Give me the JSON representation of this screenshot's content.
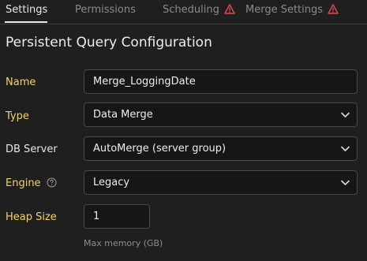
{
  "tabs": [
    {
      "label": "Settings",
      "active": true,
      "warning": false
    },
    {
      "label": "Permissions",
      "active": false,
      "warning": false
    },
    {
      "label": "Scheduling",
      "active": false,
      "warning": true
    },
    {
      "label": "Merge Settings",
      "active": false,
      "warning": true
    }
  ],
  "section_title": "Persistent Query Configuration",
  "form": {
    "name": {
      "label": "Name",
      "value": "Merge_LoggingDate"
    },
    "type": {
      "label": "Type",
      "value": "Data Merge"
    },
    "db_server": {
      "label": "DB Server",
      "value": "AutoMerge (server group)"
    },
    "engine": {
      "label": "Engine",
      "value": "Legacy"
    },
    "heap_size": {
      "label": "Heap Size",
      "value": "1",
      "hint": "Max memory (GB)"
    }
  },
  "colors": {
    "accent_label": "#f2d36b",
    "warning": "#e5484d",
    "background": "#1f1f20"
  },
  "icons": {
    "warning": "warning-triangle-icon",
    "chevron": "chevron-down-icon",
    "help": "help-circle-icon"
  }
}
